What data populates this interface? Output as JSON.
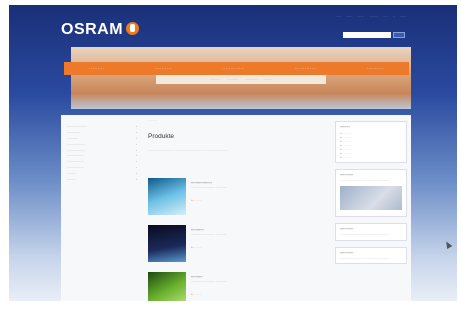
{
  "header": {
    "logo_text": "OSRAM",
    "util_links": [
      "·····",
      "······",
      "·······",
      "·········",
      "·····",
      "··",
      "·······"
    ]
  },
  "nav": {
    "items": [
      "·········",
      "··········",
      "·············",
      "·············",
      "··········"
    ]
  },
  "hero": {
    "bar_items": [
      "··········",
      "···········",
      "············",
      "········"
    ]
  },
  "sidebar": {
    "items": [
      "····················",
      "·············",
      "···········",
      "··················",
      "··················",
      "·················",
      "·················",
      "·················",
      "·········",
      "·········"
    ]
  },
  "main": {
    "breadcrumb": "··········",
    "title": "Produkte",
    "intro": "·························· ·························· ··························",
    "teasers": [
      {
        "title": "··················",
        "text": "························· ·············",
        "link": "» ·········"
      },
      {
        "title": "···········",
        "text": "························· ·············",
        "link": "» ·········"
      },
      {
        "title": "··········",
        "text": "························· ·············",
        "link": "» ·········"
      }
    ]
  },
  "right": {
    "box1": {
      "title": "·········",
      "links": [
        "» ·········",
        "» ·········",
        "» ·········",
        "» ·········",
        "» ·········",
        "» ·········",
        "» ·········"
      ]
    },
    "box2": {
      "title": "············",
      "text": "·························· ··························"
    },
    "box3": {
      "title": "············",
      "text": "·························· ··························"
    },
    "box4": {
      "title": "············",
      "text": "·························· ··························"
    }
  },
  "colors": {
    "accent": "#ec7a2a",
    "header_bg": "#1a2f78"
  }
}
